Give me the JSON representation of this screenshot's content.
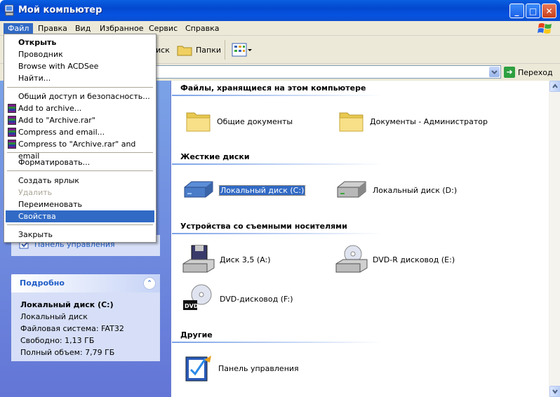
{
  "window": {
    "title": "Мой компьютер",
    "buttons": {
      "minimize": "_",
      "maximize": "□",
      "close": "✕"
    }
  },
  "menubar": {
    "items": [
      "Файл",
      "Правка",
      "Вид",
      "Избранное",
      "Сервис",
      "Справка"
    ],
    "active": "Файл"
  },
  "toolbar": {
    "search_partial": "иск",
    "folders": "Папки"
  },
  "addressbar": {
    "go_label": "Переход"
  },
  "file_menu": {
    "items": [
      {
        "label": "Открыть"
      },
      {
        "label": "Проводник"
      },
      {
        "label": "Browse with ACDSee"
      },
      {
        "label": "Найти..."
      },
      {
        "label": "Общий доступ и безопасность..."
      },
      {
        "label": "Add to archive..."
      },
      {
        "label": "Add to \"Archive.rar\""
      },
      {
        "label": "Compress and email..."
      },
      {
        "label": "Compress to \"Archive.rar\" and email"
      },
      {
        "label": "Форматировать..."
      },
      {
        "label": "Создать ярлык"
      },
      {
        "label": "Удалить"
      },
      {
        "label": "Переименовать"
      },
      {
        "label": "Свойства"
      },
      {
        "label": "Закрыть"
      }
    ]
  },
  "taskpane": {
    "control_panel_link": "Панель управления",
    "details": {
      "header": "Подробно",
      "collapse": "⌃",
      "name": "Локальный диск (C:)",
      "type": "Локальный диск",
      "fs": "Файловая система: FAT32",
      "free": "Свободно: 1,13 ГБ",
      "total": "Полный объем: 7,79 ГБ"
    }
  },
  "content": {
    "groups": [
      {
        "title": "Файлы, хранящиеся на этом компьютере",
        "items": [
          "Общие документы",
          "Документы - Администратор"
        ]
      },
      {
        "title": "Жесткие диски",
        "items": [
          "Локальный диск (C:)",
          "Локальный диск (D:)"
        ]
      },
      {
        "title": "Устройства со съемными носителями",
        "items": [
          "Диск 3,5 (A:)",
          "DVD-R дисковод (E:)",
          "DVD-дисковод (F:)"
        ]
      },
      {
        "title": "Другие",
        "items": [
          "Панель управления"
        ]
      }
    ]
  },
  "colors": {
    "titlebar": "#0553e0",
    "selection": "#316ac5",
    "taskpane": "#7ba2e7",
    "link": "#215dc6"
  }
}
